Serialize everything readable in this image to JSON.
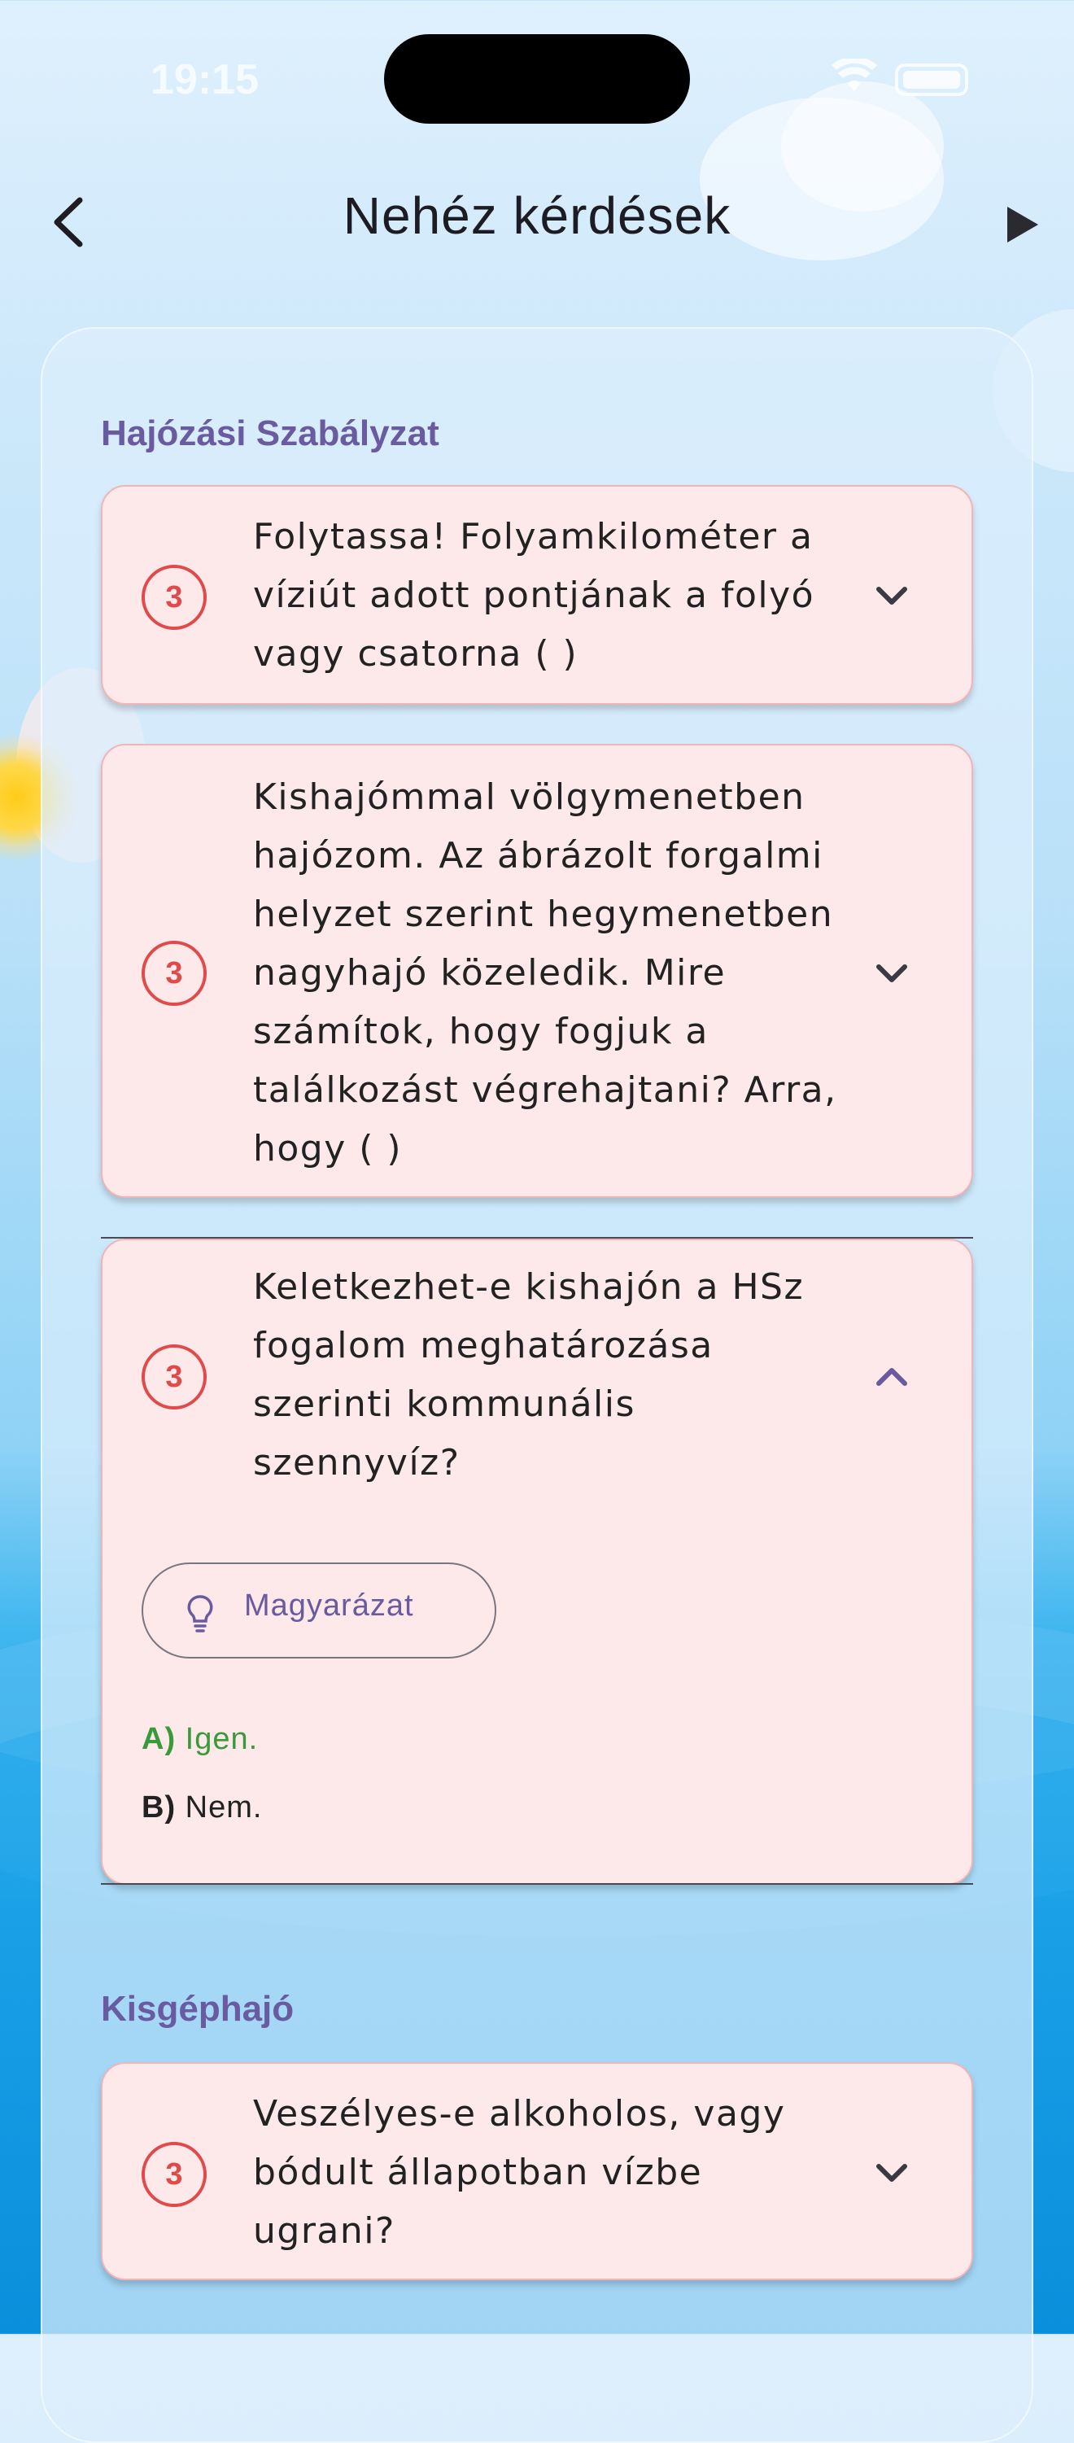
{
  "status_bar": {
    "time": "19:15"
  },
  "header": {
    "title": "Nehéz kérdések"
  },
  "sections": [
    {
      "title": "Hajózási Szabályzat",
      "questions": [
        {
          "badge": "3",
          "text": "Folytassa! Folyamkilométer a víziút adott pontjának a folyó vagy csatorna (   )"
        },
        {
          "badge": "3",
          "text": "Kishajómmal völgymenetben hajózom. Az ábrázolt forgalmi helyzet szerint hegymenetben nagyhajó közeledik. Mire számítok, hogy fogjuk a találkozást végrehajtani? Arra, hogy (   )"
        },
        {
          "badge": "3",
          "text": "Keletkezhet-e kishajón a HSz fogalom meghatározása szerinti kommunális szennyvíz?",
          "explain_label": "Magyarázat",
          "answers": [
            {
              "key": "A)",
              "text": "Igen.",
              "correct": true
            },
            {
              "key": "B)",
              "text": "Nem.",
              "correct": false
            }
          ]
        }
      ]
    },
    {
      "title": "Kisgéphajó",
      "questions": [
        {
          "badge": "3",
          "text": "Veszélyes-e alkoholos, vagy bódult állapotban vízbe ugrani?"
        }
      ]
    }
  ],
  "colors": {
    "accent": "#6a5aa0",
    "badge": "#e04a4a",
    "card_bg": "#fde8ea",
    "correct": "#3a9a3a"
  }
}
